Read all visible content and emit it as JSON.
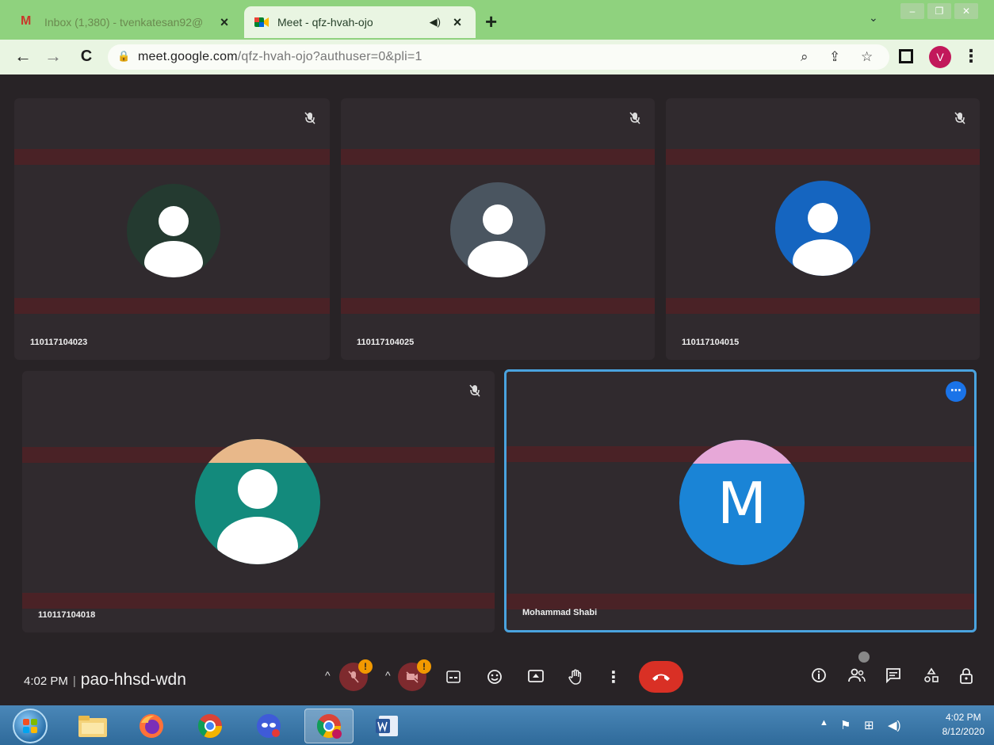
{
  "browser": {
    "tabs": [
      {
        "label": "Inbox (1,380) - tvenkatesan92@",
        "close": "×",
        "active": false,
        "icon": "gmail-icon"
      },
      {
        "label": "Meet - qfz-hvah-ojo",
        "close": "×",
        "active": true,
        "icon": "meet-icon"
      }
    ],
    "new_tab": "+",
    "tab_search": "⌄",
    "window_buttons": [
      "–",
      "❐",
      "✕"
    ],
    "nav": {
      "back": "←",
      "forward": "→",
      "reload": "C"
    },
    "url_host": "meet.google.com",
    "url_path": "/qfz-hvah-ojo?authuser=0&pli=1",
    "profile_initial": "V",
    "menu": "⋮"
  },
  "meet": {
    "participants": [
      {
        "name": "110117104023",
        "avatar_color": "#243a30",
        "muted": true
      },
      {
        "name": "110117104025",
        "avatar_color": "#4a5560",
        "muted": true
      },
      {
        "name": "110117104015",
        "avatar_color": "#1565c0",
        "muted": true
      },
      {
        "name": "110117104018",
        "avatar_color": "#138a7c",
        "cap_color": "#e8b88a",
        "muted": true
      },
      {
        "name": "Mohammad Shabi",
        "avatar_color": "#1a84d6",
        "cap_color": "#e7a8d8",
        "initial": "M",
        "pinned": true
      }
    ],
    "more_options": "⋯"
  },
  "controls": {
    "time": "4:02 PM",
    "separator": "|",
    "meeting_code": "pao-hhsd-wdn",
    "warning_badge": "!",
    "caret": "^"
  },
  "taskbar": {
    "tray_time": "4:02 PM",
    "tray_date": "8/12/2020"
  },
  "colors": {
    "meet_bg": "#282326",
    "tile_bg": "#302a2e",
    "hangup_red": "#d93025",
    "pinned_blue": "#4aa3df",
    "chrome_green": "#8fd27e"
  }
}
